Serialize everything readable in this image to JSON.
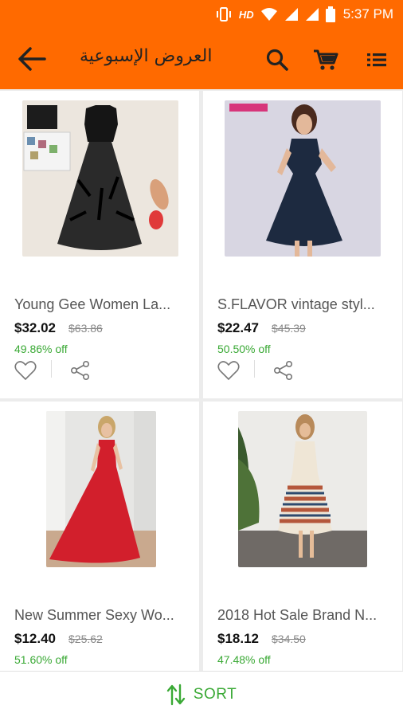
{
  "status_bar": {
    "hd": "HD",
    "time": "5:37 PM"
  },
  "header": {
    "title": "العروض الإسبوعية"
  },
  "products": [
    {
      "name": "Young Gee Women La...",
      "price": "$32.02",
      "old_price": "$63.86",
      "discount": "49.86% off"
    },
    {
      "name": "S.FLAVOR vintage styl...",
      "price": "$22.47",
      "old_price": "$45.39",
      "discount": "50.50% off"
    },
    {
      "name": "New Summer Sexy Wo...",
      "price": "$12.40",
      "old_price": "$25.62",
      "discount": "51.60% off"
    },
    {
      "name": "2018 Hot Sale Brand N...",
      "price": "$18.12",
      "old_price": "$34.50",
      "discount": "47.48% off"
    }
  ],
  "bottom_bar": {
    "sort_label": "SORT"
  },
  "colors": {
    "accent": "#ff6a00",
    "discount": "#3aa935"
  }
}
